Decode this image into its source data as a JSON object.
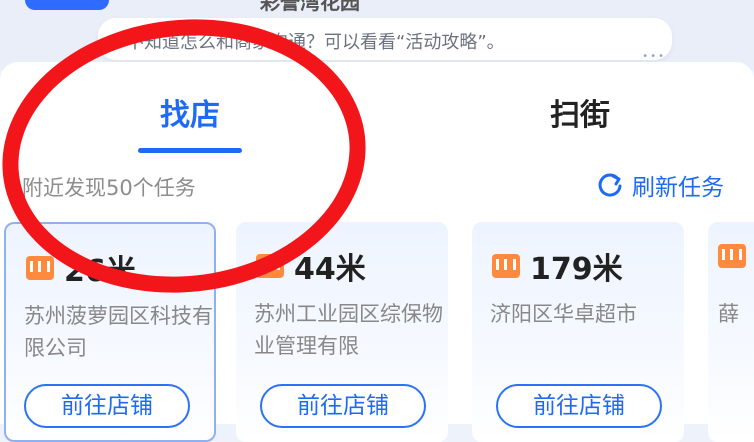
{
  "header": {
    "title": "彩誉湾花园",
    "tip": "不知道怎么和商家沟通？可以看看“活动攻略”。"
  },
  "tabs": [
    {
      "label": "找店",
      "active": true
    },
    {
      "label": "扫街",
      "active": false
    }
  ],
  "nearby": {
    "summary": "附近发现50个任务",
    "refresh_label": "刷新任务"
  },
  "stores": [
    {
      "distance": "26米",
      "name": "苏州菠萝园区科技有限公司",
      "button": "前往店铺"
    },
    {
      "distance": "44米",
      "name": "苏州工业园区综保物业管理有限",
      "button": "前往店铺"
    },
    {
      "distance": "179米",
      "name": "济阳区华卓超市",
      "button": "前往店铺"
    },
    {
      "distance": "",
      "name": "薛",
      "button": ""
    }
  ],
  "colors": {
    "accent": "#1d6bf5",
    "shop_icon": "#ff8a3d",
    "annotation": "#f2151a"
  }
}
